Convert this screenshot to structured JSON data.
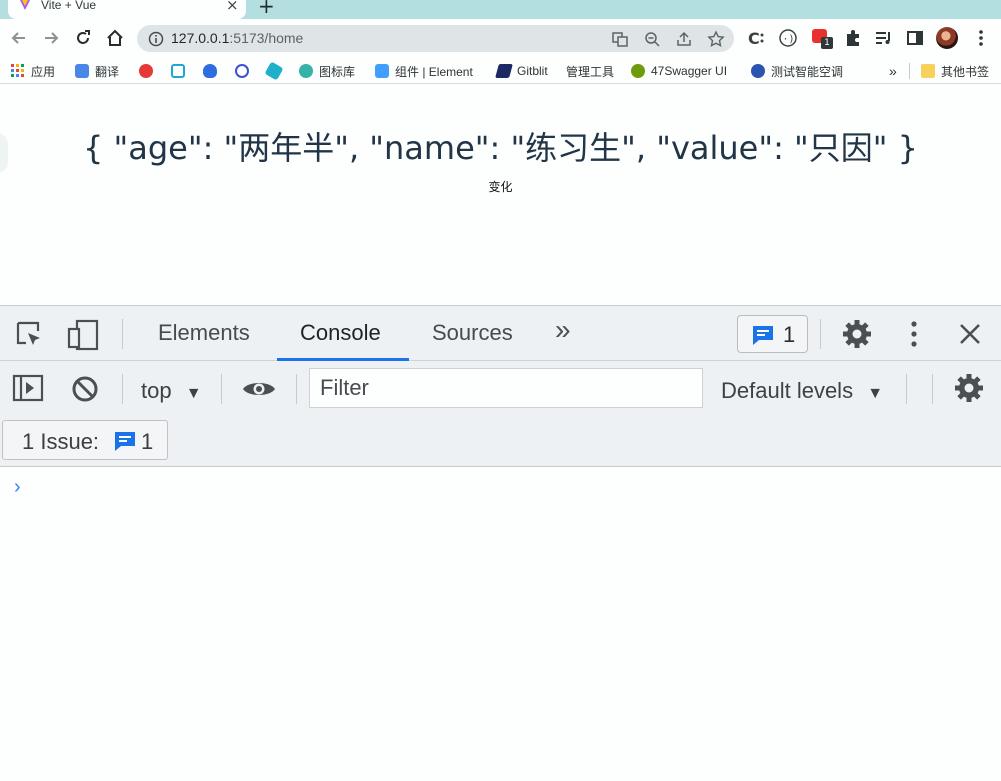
{
  "browser": {
    "tab": {
      "title": "Vite + Vue",
      "close_glyph": "×"
    },
    "new_tab_glyph": "+",
    "url": {
      "host": "127.0.0.1",
      "path": ":5173/home"
    },
    "bookmarks": [
      {
        "label": "应用",
        "icon": "apps-grid-icon",
        "color": "#e8453c"
      },
      {
        "label": "翻译",
        "icon": "translate-icon",
        "color": "#4a86e8"
      },
      {
        "label": "",
        "icon": "g-red-icon",
        "color": "#e53935"
      },
      {
        "label": "",
        "icon": "bilibili-icon",
        "color": "#1ea7d3"
      },
      {
        "label": "",
        "icon": "baidu-icon",
        "color": "#2e6de0"
      },
      {
        "label": "",
        "icon": "search-blue-icon",
        "color": "#3d4fd6"
      },
      {
        "label": "",
        "icon": "hexagon-icon",
        "color": "#1fb0c9"
      },
      {
        "label": "图标库",
        "icon": "iconfont-icon",
        "color": "#36b3a8"
      },
      {
        "label": "组件 | Element",
        "icon": "element-icon",
        "color": "#409eff"
      },
      {
        "label": "Gitblit",
        "icon": "gitblit-icon",
        "color": "#1b2a64"
      },
      {
        "label": "管理工具",
        "icon": "",
        "color": ""
      },
      {
        "label": "47Swagger UI",
        "icon": "swagger-icon",
        "color": "#6e9a0e"
      },
      {
        "label": "测试智能空调",
        "icon": "aircon-icon",
        "color": "#2a55b0"
      }
    ],
    "bookmarks_overflow": "»",
    "other_bookmarks": "其他书签",
    "extension_badge": "1"
  },
  "page": {
    "json_text": "{ \"age\": \"两年半\", \"name\": \"练习生\", \"value\": \"只因\" }",
    "change_button": "变化"
  },
  "devtools": {
    "tabs": [
      "Elements",
      "Console",
      "Sources"
    ],
    "more_tabs_glyph": "»",
    "issues_count": "1",
    "context": "top",
    "filter_placeholder": "Filter",
    "levels": "Default levels",
    "issue_pill_label": "1 Issue:",
    "issue_pill_count": "1",
    "prompt_glyph": "›",
    "accent": "#1a73e8"
  }
}
